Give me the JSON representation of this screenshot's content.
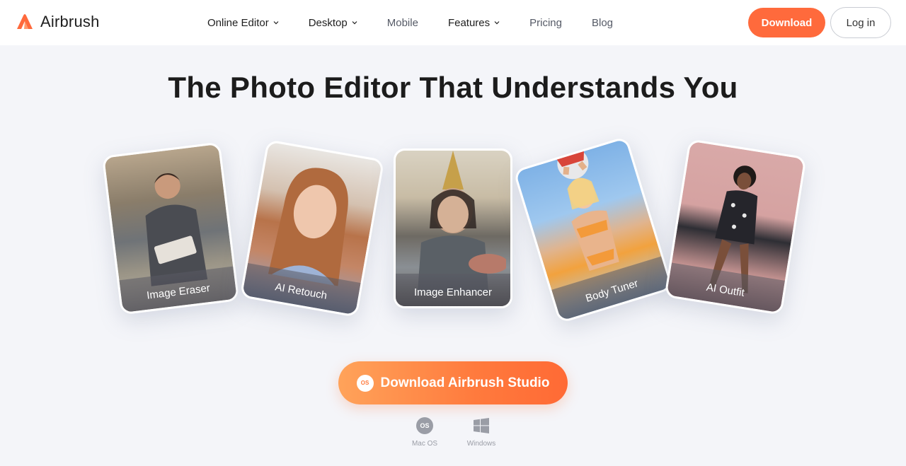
{
  "brand": {
    "name": "Airbrush",
    "accent": "#ff6a3c"
  },
  "nav": {
    "items": [
      {
        "label": "Online Editor",
        "has_dropdown": true
      },
      {
        "label": "Desktop",
        "has_dropdown": true
      },
      {
        "label": "Mobile",
        "has_dropdown": false
      },
      {
        "label": "Features",
        "has_dropdown": true
      },
      {
        "label": "Pricing",
        "has_dropdown": false
      },
      {
        "label": "Blog",
        "has_dropdown": false
      }
    ],
    "download_label": "Download",
    "login_label": "Log in"
  },
  "hero": {
    "title": "The Photo Editor That Understands You",
    "cards": [
      {
        "caption": "Image Eraser"
      },
      {
        "caption": "AI Retouch"
      },
      {
        "caption": "Image Enhancer"
      },
      {
        "caption": "Body Tuner"
      },
      {
        "caption": "AI Outfit"
      }
    ],
    "cta_label": "Download Airbrush Studio",
    "cta_icon_text": "OS",
    "platforms": [
      {
        "label": "Mac OS",
        "icon": "macos-icon",
        "icon_text": "OS"
      },
      {
        "label": "Windows",
        "icon": "windows-icon"
      }
    ]
  }
}
